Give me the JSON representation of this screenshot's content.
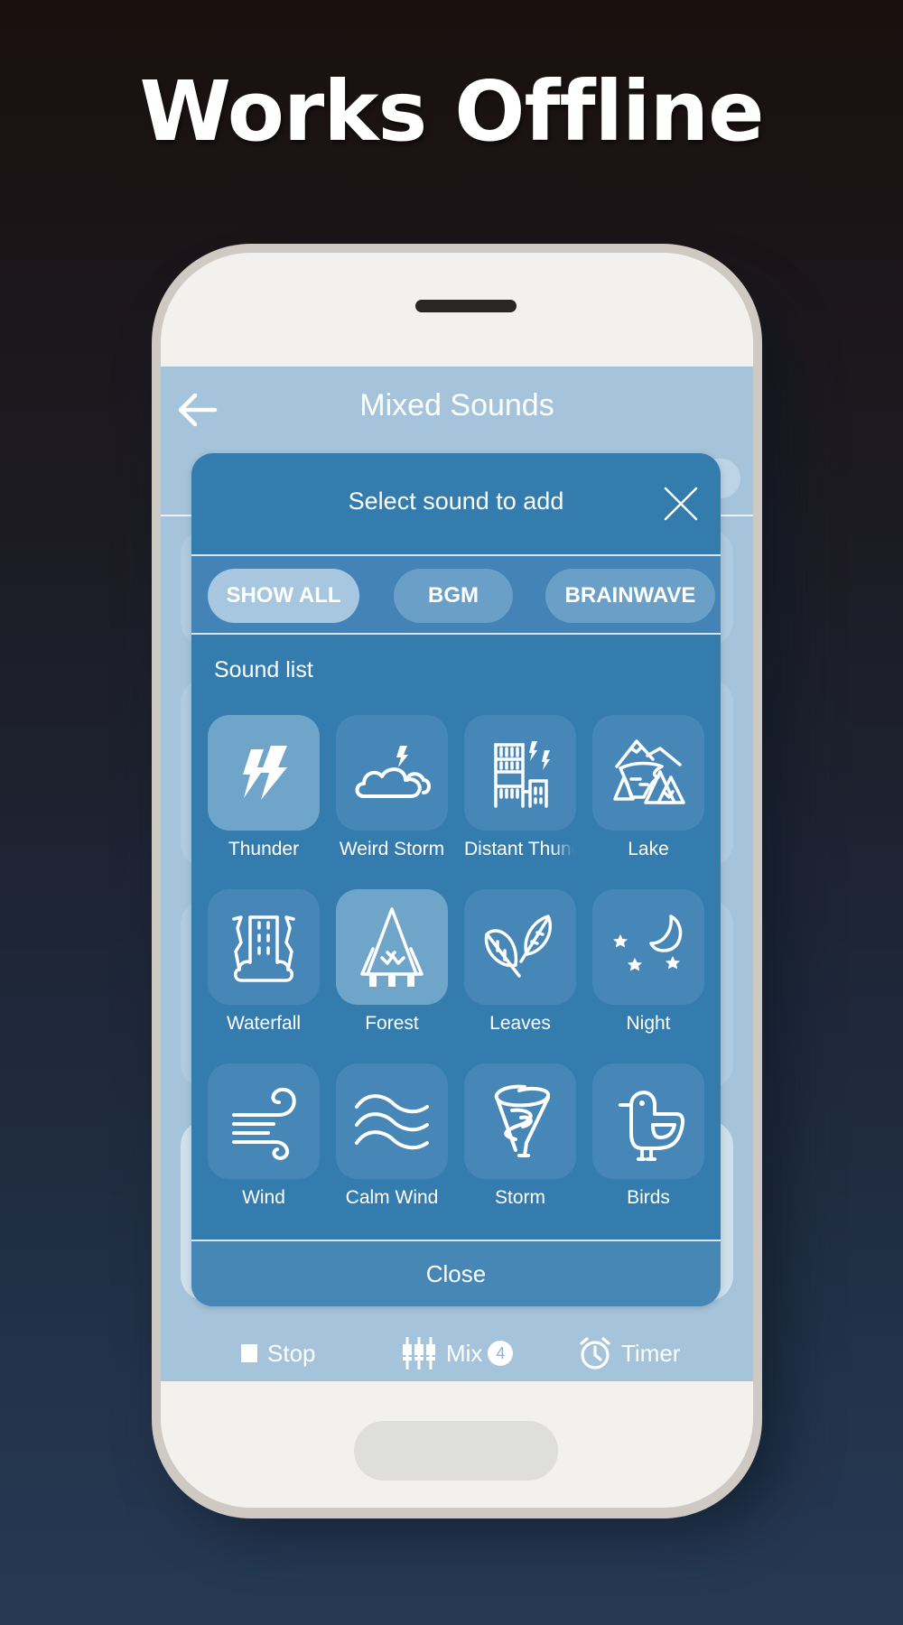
{
  "promo": {
    "headline": "Works Offline"
  },
  "appbar": {
    "title": "Mixed Sounds",
    "back_icon": "arrow-left-icon"
  },
  "dialog": {
    "title": "Select sound to add",
    "close_icon": "close-x-icon",
    "filters": [
      {
        "label": "SHOW ALL",
        "active": true
      },
      {
        "label": "BGM",
        "active": false
      },
      {
        "label": "BRAINWAVE",
        "active": false
      }
    ],
    "section_label": "Sound list",
    "sounds": [
      {
        "label": "Thunder",
        "icon": "thunder-icon",
        "selected": true
      },
      {
        "label": "Weird Storm",
        "icon": "cloud-lightning-icon",
        "selected": false
      },
      {
        "label": "Distant Thunder",
        "icon": "building-lightning-icon",
        "selected": false
      },
      {
        "label": "Lake",
        "icon": "lake-mountains-icon",
        "selected": false
      },
      {
        "label": "Waterfall",
        "icon": "waterfall-icon",
        "selected": false
      },
      {
        "label": "Forest",
        "icon": "forest-icon",
        "selected": true
      },
      {
        "label": "Leaves",
        "icon": "leaves-icon",
        "selected": false
      },
      {
        "label": "Night",
        "icon": "moon-stars-icon",
        "selected": false
      },
      {
        "label": "Wind",
        "icon": "wind-icon",
        "selected": false
      },
      {
        "label": "Calm Wind",
        "icon": "waves-icon",
        "selected": false
      },
      {
        "label": "Storm",
        "icon": "tornado-icon",
        "selected": false
      },
      {
        "label": "Birds",
        "icon": "bird-icon",
        "selected": false
      }
    ],
    "close_label": "Close"
  },
  "bottom_bar": {
    "stop_label": "Stop",
    "mix_label": "Mix",
    "mix_count": "4",
    "timer_label": "Timer"
  },
  "colors": {
    "dialog_bg": "#347cae",
    "screen_bg": "#a5c3da",
    "tile_bg": "#4787b8",
    "tile_selected_bg": "#70a5ca"
  }
}
